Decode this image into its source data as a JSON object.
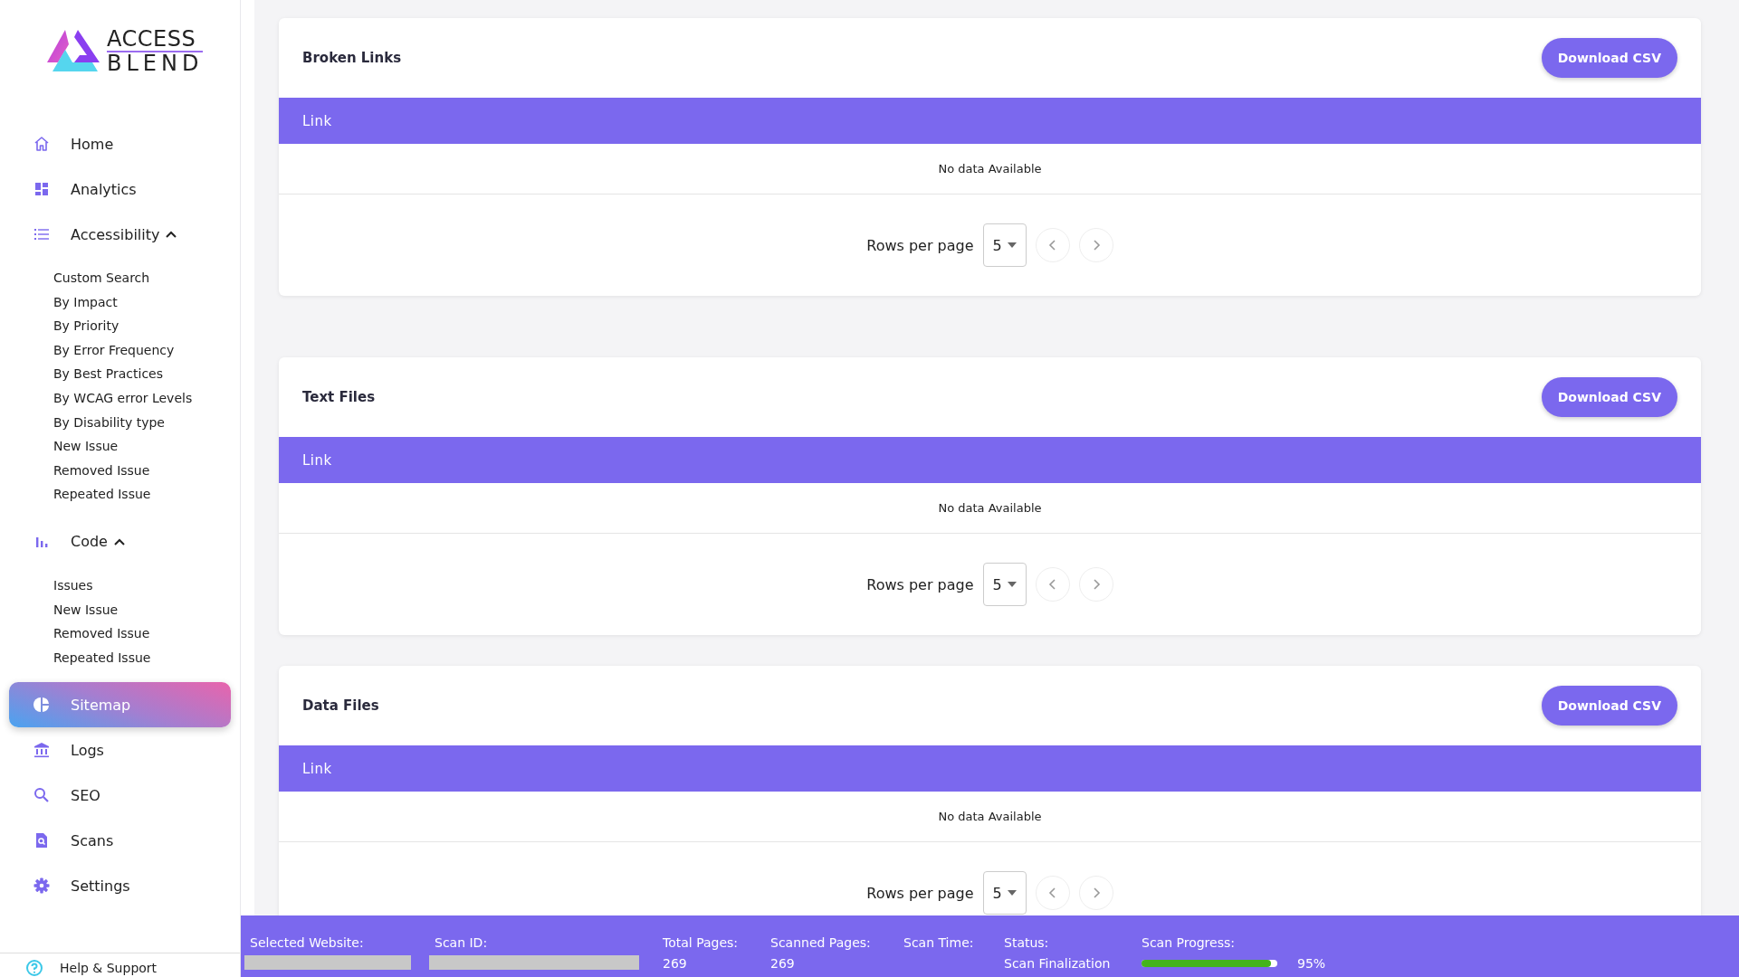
{
  "sidebar": {
    "logo": {
      "line1": "ACCESS",
      "line2": "BLEND"
    },
    "items": [
      {
        "label": "Home",
        "selected": false
      },
      {
        "label": "Analytics",
        "selected": false
      },
      {
        "label": "Accessibility",
        "selected": false,
        "expanded": true,
        "children": [
          {
            "label": "Custom Search"
          },
          {
            "label": "By Impact"
          },
          {
            "label": "By Priority"
          },
          {
            "label": "By Error Frequency"
          },
          {
            "label": "By Best Practices"
          },
          {
            "label": "By WCAG error Levels"
          },
          {
            "label": "By Disability type"
          },
          {
            "label": "New Issue"
          },
          {
            "label": "Removed Issue"
          },
          {
            "label": "Repeated Issue"
          }
        ]
      },
      {
        "label": "Code",
        "selected": false,
        "expanded": true,
        "children": [
          {
            "label": "Issues"
          },
          {
            "label": "New Issue"
          },
          {
            "label": "Removed Issue"
          },
          {
            "label": "Repeated Issue"
          }
        ]
      },
      {
        "label": "Sitemap",
        "selected": true
      },
      {
        "label": "Logs",
        "selected": false
      },
      {
        "label": "SEO",
        "selected": false
      },
      {
        "label": "Scans",
        "selected": false
      },
      {
        "label": "Settings",
        "selected": false
      }
    ],
    "help": {
      "label": "Help & Support"
    }
  },
  "sections": [
    {
      "title": "Broken Links",
      "button": "Download CSV",
      "columns": [
        "Link"
      ],
      "empty_text": "No data Available",
      "rows_per_page_label": "Rows per page",
      "rows_per_page": "5"
    },
    {
      "title": "Text Files",
      "button": "Download CSV",
      "columns": [
        "Link"
      ],
      "empty_text": "No data Available",
      "rows_per_page_label": "Rows per page",
      "rows_per_page": "5"
    },
    {
      "title": "Data Files",
      "button": "Download CSV",
      "columns": [
        "Link"
      ],
      "empty_text": "No data Available",
      "rows_per_page_label": "Rows per page",
      "rows_per_page": "5"
    }
  ],
  "status_bar": {
    "fields": [
      {
        "kind": "redacted",
        "label": "Selected Website:"
      },
      {
        "kind": "redacted",
        "label": "Scan ID:"
      },
      {
        "kind": "text",
        "label": "Total Pages:",
        "value": "269"
      },
      {
        "kind": "text",
        "label": "Scanned Pages:",
        "value": "269"
      },
      {
        "kind": "text",
        "label": "Scan Time:"
      },
      {
        "kind": "text",
        "label": "Status:",
        "value": "Scan Finalization"
      },
      {
        "kind": "progress",
        "label": "Scan Progress:",
        "level": 0.95,
        "reading": "95%"
      }
    ]
  }
}
